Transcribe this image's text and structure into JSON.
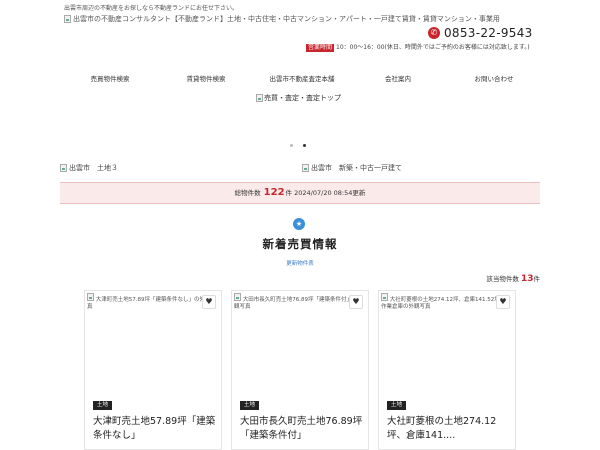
{
  "header": {
    "tagline": "出雲市周辺の不動産をお探しなら不動産ランドにお任せ下さい。",
    "logo_alt": "出雲市の不動産コンサルタント【不動産ランド】土地・中古住宅・中古マンション・アパート・一戸建て賃貸・賃貸マンション・事業用",
    "phone_icon": "phone-icon",
    "phone_number": "0853-22-9543",
    "hours_badge": "営業時間",
    "hours_text": "10：00～16：00(休日、時間外ではご予約のお客様には対応致します。)"
  },
  "nav": {
    "items": [
      {
        "label": "売買物件検索"
      },
      {
        "label": "賃貸物件検索"
      },
      {
        "label": "出雲市不動産査定本舗"
      },
      {
        "label": "会社案内"
      },
      {
        "label": "お問い合わせ"
      }
    ],
    "sub_label": "売買・査定・査定トップ"
  },
  "slider": {
    "left_alt": "出雲市　土地３",
    "right_alt": "出雲市　新築・中古一戸建て",
    "dot_count": 2,
    "active_dot": 1
  },
  "summary": {
    "prefix": "総物件数",
    "count": "122",
    "unit": "件",
    "updated": "2024/07/20 08:54更新"
  },
  "section": {
    "icon": "star-badge-icon",
    "title": "新着売買情報",
    "link": "更新物件表"
  },
  "results": {
    "prefix": "該当物件数",
    "count": "13",
    "unit": "件"
  },
  "cards": [
    {
      "img_alt": "大津町売土地57.89坪「建築条件なし」の外観写真",
      "tag": "土地",
      "title": "大津町売土地57.89坪「建築条件なし」",
      "fav_icon": "heart-icon"
    },
    {
      "img_alt": "大田市長久町売土地76.89坪「建築条件付」の外観写真",
      "tag": "土地",
      "title": "大田市長久町売土地76.89坪「建築条件付」",
      "fav_icon": "heart-icon"
    },
    {
      "img_alt": "大社町菱根の土地274.12坪、倉庫141.52坪中古作業倉庫の外観写真",
      "tag": "土地",
      "title": "大社町菱根の土地274.12坪、倉庫141....",
      "fav_icon": "heart-icon"
    }
  ],
  "colors": {
    "accent": "#c9252d",
    "link": "#3a7cc7",
    "icon_blue": "#3a8fd8",
    "count_bg": "#fbeaea"
  }
}
